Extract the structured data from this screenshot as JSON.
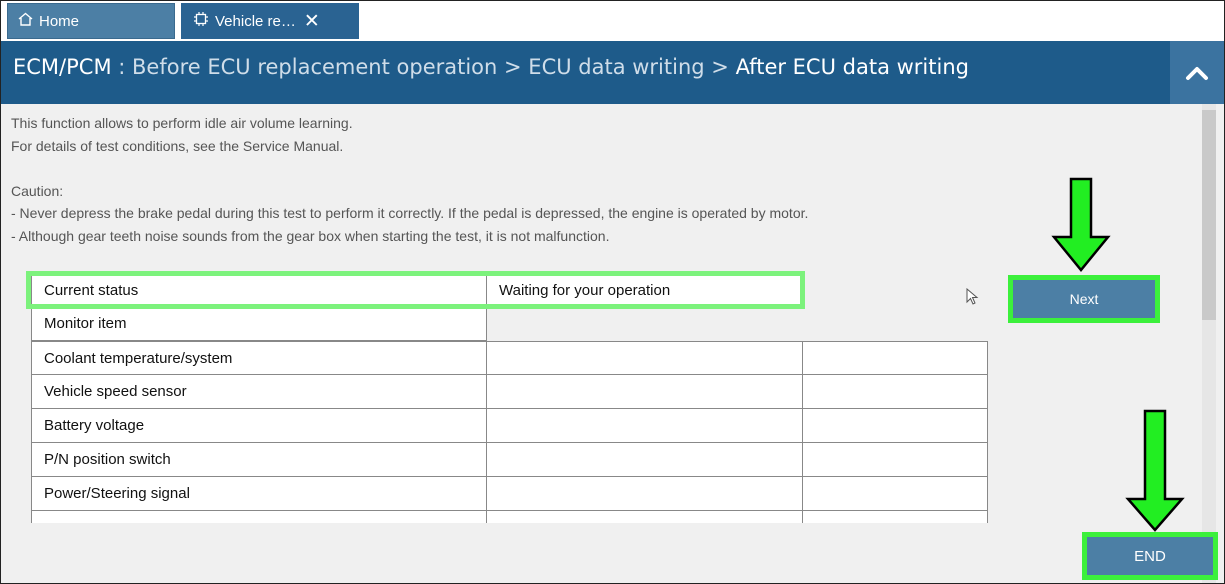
{
  "tabs": {
    "home": {
      "label": "Home",
      "icon": "home-icon"
    },
    "vehicle": {
      "label": "Vehicle re…",
      "icon": "chip-icon",
      "close": "✕"
    }
  },
  "header": {
    "module": "ECM/PCM",
    "sep": " : ",
    "crumb1": "Before ECU replacement operation",
    "arrow1": " > ",
    "crumb2": "ECU data writing",
    "arrow2": " > ",
    "current": "After ECU data writing",
    "collapse_icon": "chevron-up-icon"
  },
  "intro": {
    "line1": "This function allows to perform idle air volume learning.",
    "line2": "For details of test conditions, see the Service Manual.",
    "line3": "",
    "line4": "Caution:",
    "line5": "- Never depress the brake pedal during this test to perform it correctly. If the pedal is depressed, the engine is operated by motor.",
    "line6": "- Although gear teeth noise sounds from the gear box when starting the test, it is not malfunction."
  },
  "table": {
    "status_label": "Current status",
    "status_value": "Waiting for your operation",
    "monitor_label": "Monitor item",
    "items": [
      "Coolant temperature/system",
      "Vehicle speed sensor",
      "Battery voltage",
      "P/N position switch",
      "Power/Steering signal"
    ]
  },
  "buttons": {
    "next": "Next",
    "end": "END"
  },
  "colors": {
    "header": "#1e5b8a",
    "button": "#4c7fa5",
    "highlight": "#3cf03c",
    "arrow": "#22ee22"
  }
}
